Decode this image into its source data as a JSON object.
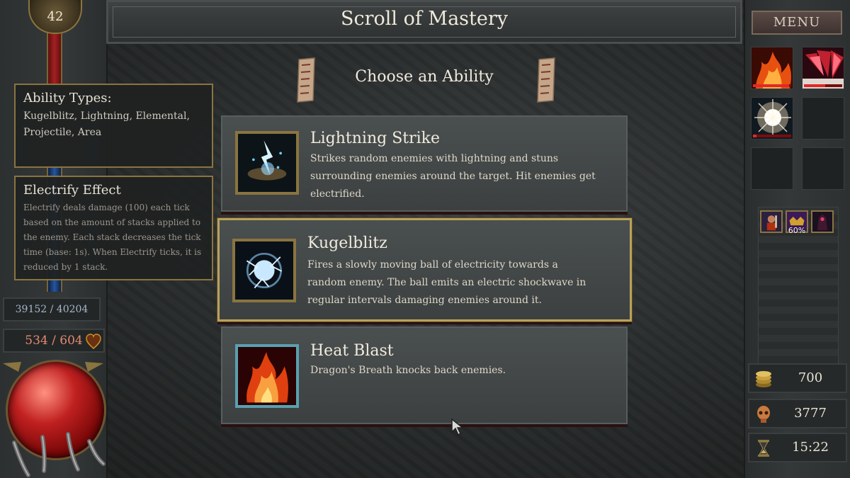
{
  "header": {
    "title": "Scroll of Mastery",
    "subtitle": "Choose an Ability"
  },
  "player": {
    "level": "42",
    "xp_text": "39152 / 40204",
    "hp_text": "534 / 604"
  },
  "tooltips": {
    "ability_types": {
      "title": "Ability Types:",
      "body": "Kugelblitz, Lightning, Elemental, Projectile, Area"
    },
    "effect": {
      "title": "Electrify Effect",
      "body": "Electrify deals damage (100) each tick based on the amount of stacks applied to the enemy. Each stack decreases the tick time (base: 1s). When Electrify ticks, it is reduced by 1 stack."
    }
  },
  "abilities": [
    {
      "name": "Lightning Strike",
      "description": "Strikes random enemies with lightning and stuns surrounding enemies around the target. Hit enemies get electrified.",
      "icon": "lightning-strike-icon",
      "selected": false
    },
    {
      "name": "Kugelblitz",
      "description": "Fires a slowly moving ball of electricity towards a random enemy. The ball emits an electric shockwave in regular intervals damaging enemies around it.",
      "icon": "kugelblitz-icon",
      "selected": true
    },
    {
      "name": "Heat Blast",
      "description": "Dragon's Breath knocks back enemies.",
      "icon": "fire-icon",
      "selected": false
    }
  ],
  "menu": {
    "label": "MENU"
  },
  "ability_slots": [
    {
      "icon": "fire-icon",
      "cooldown": 0.95
    },
    {
      "icon": "dragon-breath-icon",
      "cooldown": 0.55
    },
    {
      "icon": "light-burst-icon",
      "cooldown": 0.1
    }
  ],
  "buffs": [
    {
      "icon": "warrior-buff-icon"
    },
    {
      "icon": "crown-buff-icon",
      "value": "60%"
    },
    {
      "icon": "shadow-buff-icon"
    }
  ],
  "resources": {
    "gold": "700",
    "kills": "3777",
    "time": "15:22"
  },
  "colors": {
    "accent_gold": "#b8a25c",
    "hp_text": "#e48a72",
    "xp_text": "#a4b8cc"
  }
}
